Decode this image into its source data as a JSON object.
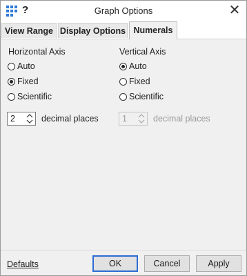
{
  "window": {
    "title": "Graph Options",
    "help_glyph": "?",
    "close_glyph": "✕",
    "icon": "grid-app-icon"
  },
  "tabs": [
    {
      "label": "View Range",
      "active": false
    },
    {
      "label": "Display Options",
      "active": false
    },
    {
      "label": "Numerals",
      "active": true
    }
  ],
  "horizontal": {
    "label": "Horizontal Axis",
    "options": [
      "Auto",
      "Fixed",
      "Scientific"
    ],
    "selected": "Fixed",
    "decimal_value": "2",
    "decimal_label": "decimal places",
    "enabled": true
  },
  "vertical": {
    "label": "Vertical Axis",
    "options": [
      "Auto",
      "Fixed",
      "Scientific"
    ],
    "selected": "Auto",
    "decimal_value": "1",
    "decimal_label": "decimal places",
    "enabled": false
  },
  "footer": {
    "defaults_label": "Defaults",
    "ok_label": "OK",
    "cancel_label": "Cancel",
    "apply_label": "Apply"
  },
  "colors": {
    "accent": "#2b6cd4",
    "icon_blue": "#2f7ad8"
  }
}
